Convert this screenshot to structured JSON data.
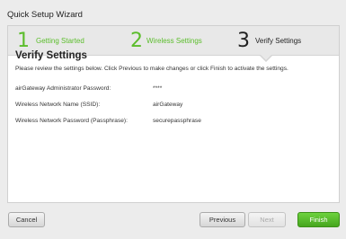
{
  "window": {
    "title": "Quick Setup Wizard"
  },
  "steps": [
    {
      "number": "1",
      "label": "Getting Started",
      "state": "done"
    },
    {
      "number": "2",
      "label": "Wireless Settings",
      "state": "done"
    },
    {
      "number": "3",
      "label": "Verify Settings",
      "state": "active"
    }
  ],
  "content": {
    "heading": "Verify Settings",
    "description": "Please review the settings below. Click Previous to make changes or click Finish to activate the settings.",
    "rows": [
      {
        "label": "airGateway Administrator Password:",
        "value": "****"
      },
      {
        "label": "Wireless Network Name (SSID):",
        "value": "airGateway"
      },
      {
        "label": "Wireless Network Password (Passphrase):",
        "value": "securepassphrase"
      }
    ]
  },
  "footer": {
    "cancel_label": "Cancel",
    "previous_label": "Previous",
    "next_label": "Next",
    "finish_label": "Finish"
  },
  "colors": {
    "accent": "#5bbd2b",
    "finish": "#4caf22"
  }
}
